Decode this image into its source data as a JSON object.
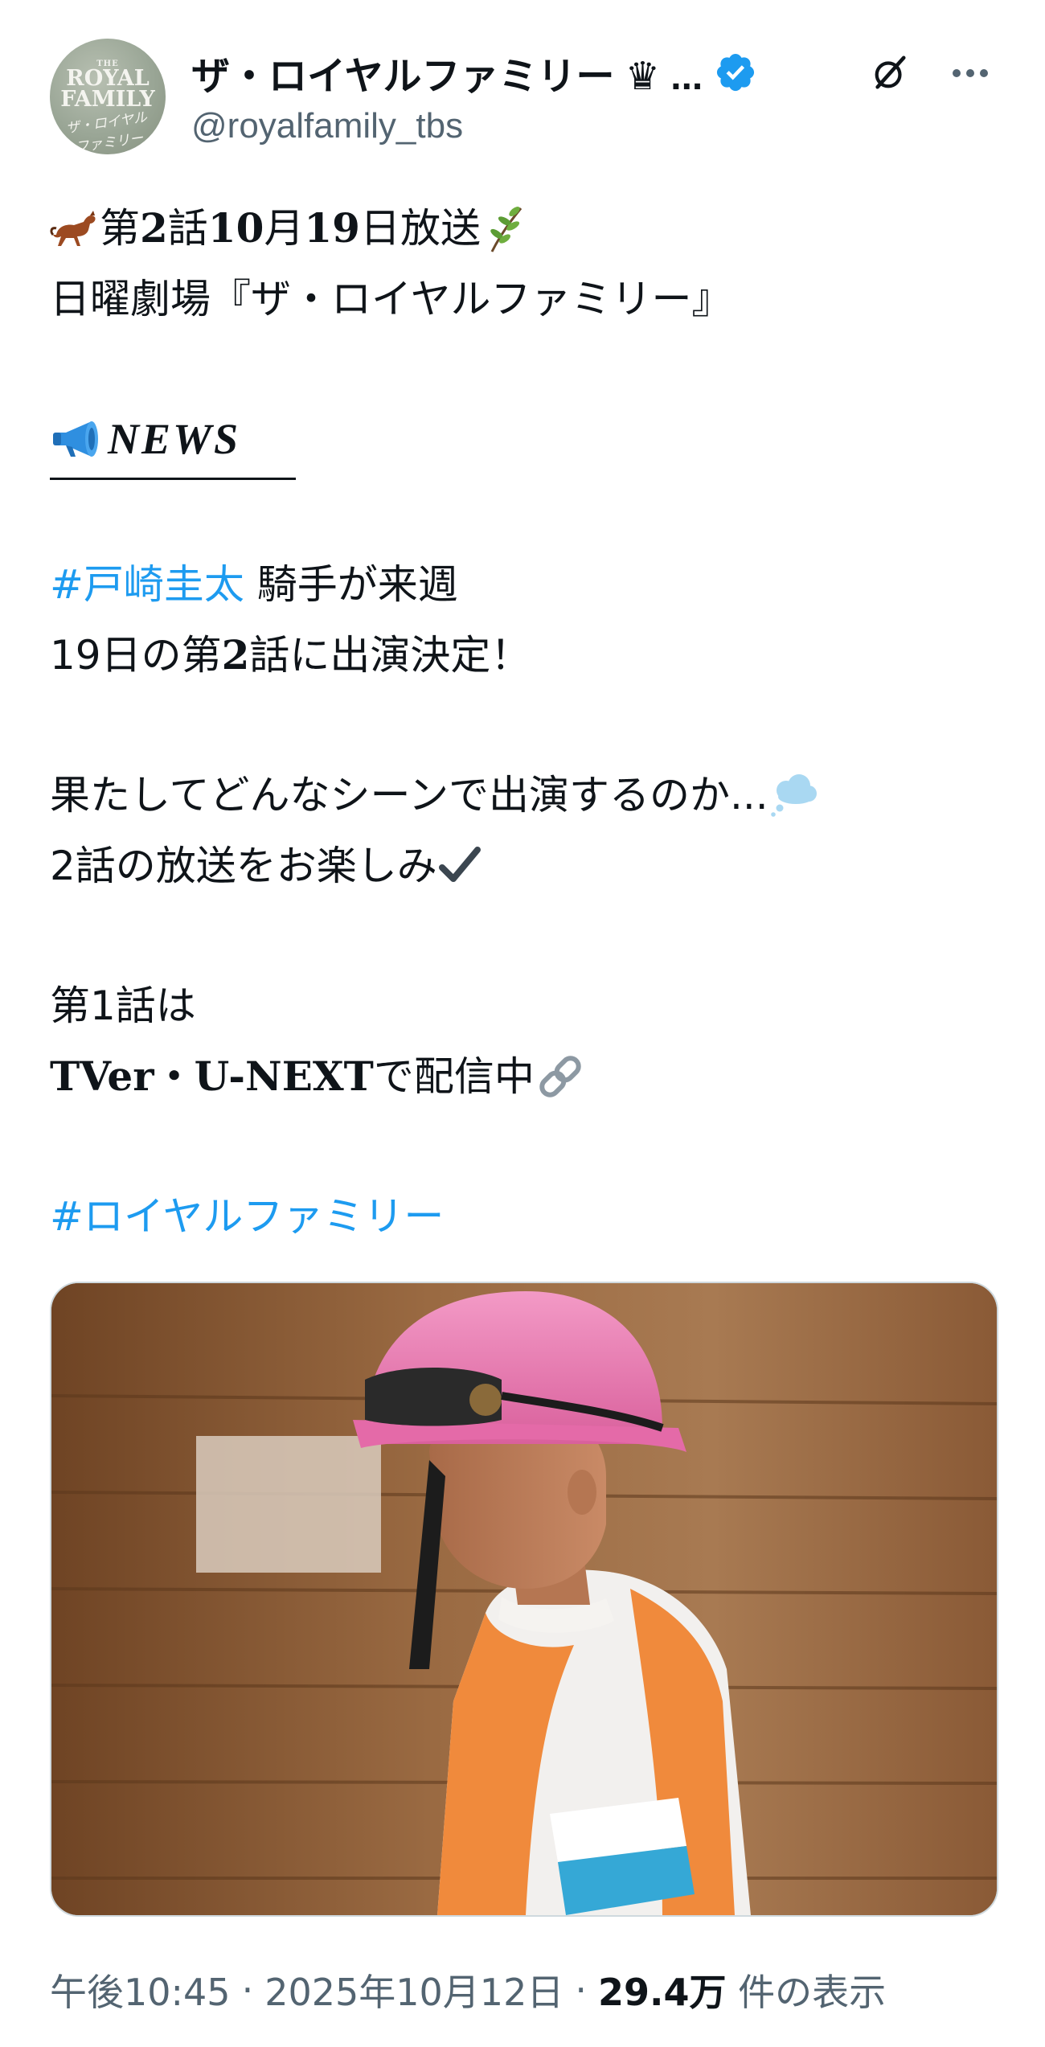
{
  "author": {
    "avatar_text": {
      "the": "THE",
      "royal": "ROYAL",
      "family": "FAMILY",
      "script": "ザ・ロイヤルファミリー"
    },
    "display_name": "ザ・ロイヤルファミリー ♛ ...",
    "handle": "@royalfamily_tbs",
    "verified_icon": "verified-badge-icon",
    "verified_color": "#1d9bf0"
  },
  "actions": {
    "grok_icon": "grok-icon",
    "more_icon": "more-dots-icon"
  },
  "tweet": {
    "line1_prefix_emoji": "horse-emoji",
    "line1_a": "第",
    "line1_b": "2",
    "line1_c": "話",
    "line1_d": "10",
    "line1_e": "月",
    "line1_f": "19",
    "line1_g": "日放送",
    "line1_suffix_emoji": "herb-emoji",
    "line2": "日曜劇場『ザ・ロイヤルファミリー』",
    "news_emoji": "megaphone-emoji",
    "news_word": "NEWS",
    "hashtag1": "#戸崎圭太",
    "line5_rest": " 騎手が来週",
    "line6_a": "19日の第",
    "line6_b": "2",
    "line6_c": "話に出演決定！",
    "line8": "果たしてどんなシーンで出演するのか...",
    "line8_emoji": "thought-balloon-emoji",
    "line9": "2話の放送をお楽しみ",
    "line9_emoji": "check-mark-icon",
    "line11": "第1話は",
    "line12_a": "TVer・U-NEXT",
    "line12_b": "で配信中",
    "line12_emoji": "link-icon",
    "hashtag2": "#ロイヤルファミリー"
  },
  "media": {
    "description_icon": "jockey-photo",
    "colors": {
      "wall": "#8a5a33",
      "helmet": "#e67ab0",
      "silks_orange": "#f08a3c",
      "silks_blue": "#35a8d6"
    }
  },
  "meta": {
    "time": "午後10:45",
    "sep1": "·",
    "date": "2025年10月12日",
    "sep2": "·",
    "views_count": "29.4万",
    "views_label": " 件の表示"
  }
}
